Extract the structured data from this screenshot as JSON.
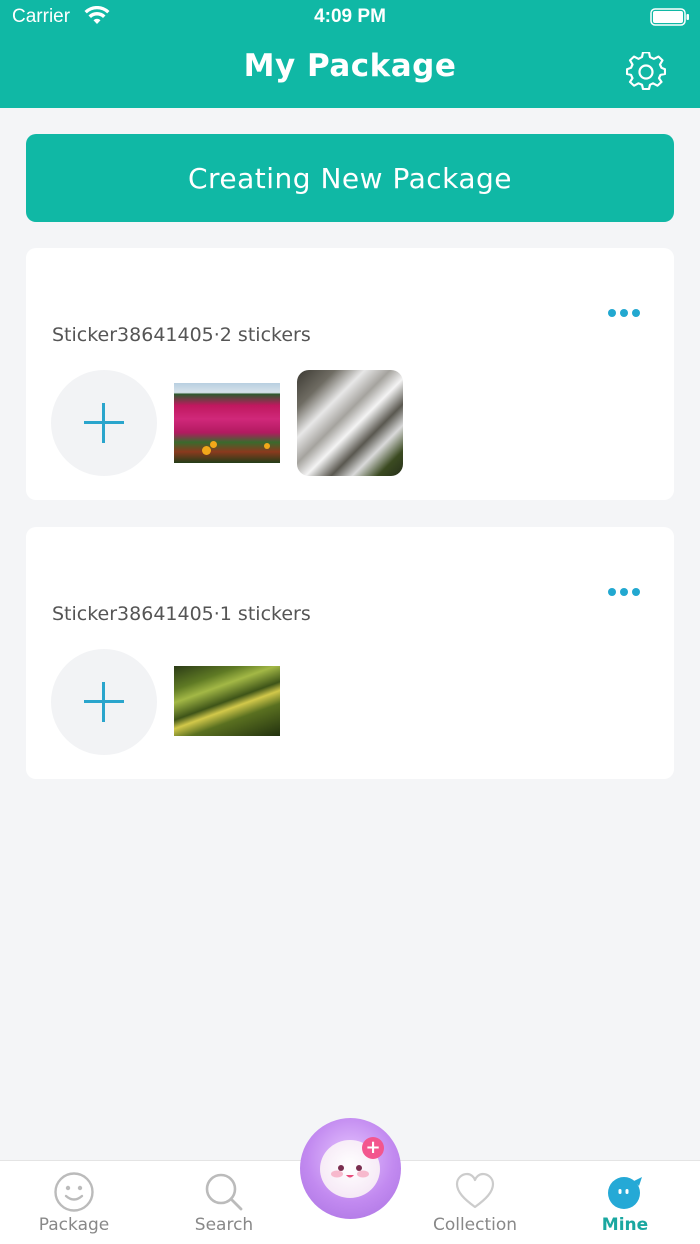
{
  "status_bar": {
    "carrier": "Carrier",
    "time": "4:09 PM"
  },
  "header": {
    "title": "My Package",
    "settings_icon": "gear-icon"
  },
  "create_button": {
    "label": "Creating New Package"
  },
  "packages": [
    {
      "title": "Sticker38641405·2 stickers",
      "stickers": [
        "flowers-image",
        "waterfall-image"
      ]
    },
    {
      "title": "Sticker38641405·1 stickers",
      "stickers": [
        "leaves-image"
      ]
    }
  ],
  "tabbar": {
    "tabs": [
      {
        "label": "Package",
        "icon": "smiley-icon"
      },
      {
        "label": "Search",
        "icon": "magnifier-icon"
      },
      {
        "label": "Collection",
        "icon": "heart-icon"
      },
      {
        "label": "Mine",
        "icon": "mine-icon",
        "active": true
      }
    ],
    "center_icon": "add-sticker-icon"
  },
  "colors": {
    "accent": "#10b8a5",
    "icon_blue": "#22a8d0",
    "active_tab": "#1aa7a0",
    "badge_pink": "#f3568e"
  }
}
